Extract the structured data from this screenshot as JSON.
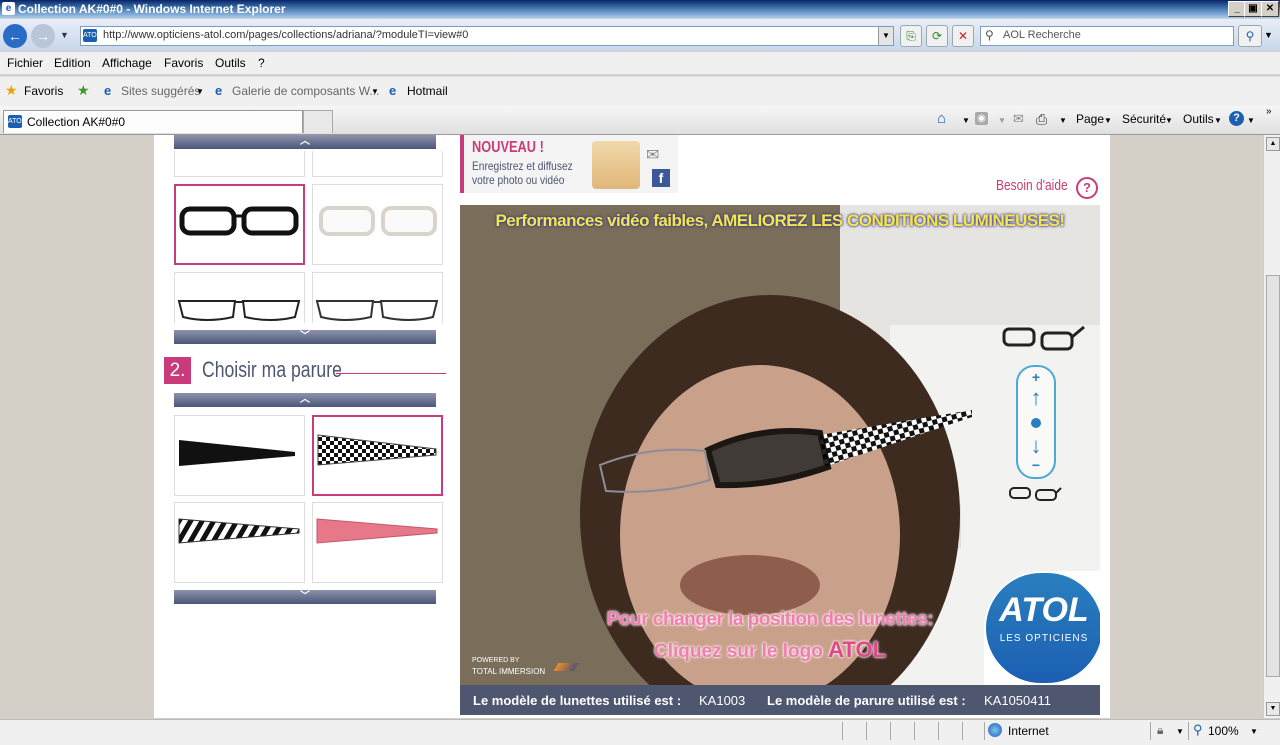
{
  "window": {
    "title": "Collection AK#0#0 - Windows Internet Explorer",
    "controls": [
      "_",
      "▣",
      "✕"
    ]
  },
  "nav": {
    "url": "http://www.opticiens-atol.com/pages/collections/adriana/?moduleTI=view#0",
    "search_placeholder": "AOL Recherche"
  },
  "menu": {
    "items": [
      "Fichier",
      "Edition",
      "Affichage",
      "Favoris",
      "Outils",
      "?"
    ]
  },
  "favorites": {
    "label": "Favoris",
    "links": [
      "Sites suggérés",
      "Galerie de composants W...",
      "Hotmail"
    ]
  },
  "tab": {
    "title": "Collection AK#0#0"
  },
  "command": {
    "items": [
      "Page",
      "Sécurité",
      "Outils"
    ]
  },
  "promo": {
    "headline": "NOUVEAU !",
    "line1": "Enregistrez et diffusez",
    "line2": "votre photo ou vidéo"
  },
  "help": {
    "label": "Besoin d'aide"
  },
  "section2": {
    "number": "2.",
    "title": "Choisir ma parure"
  },
  "webcam": {
    "warning": "Performances vidéo faibles, AMELIOREZ LES CONDITIONS LUMINEUSES!",
    "hint_line1": "Pour changer la position des lunettes:",
    "hint_line2": "Cliquez sur le logo ",
    "hint_brand": "ATOL",
    "powered_by": "POWERED BY",
    "powered_brand": "TOTAL IMMERSION",
    "logo_text": "ATOL",
    "logo_sub": "LES OPTICIENS"
  },
  "info": {
    "frame_label": "Le modèle de lunettes utilisé est :",
    "frame_value": "KA1003",
    "parure_label": "Le modèle de parure utilisé est :",
    "parure_value": "KA1050411"
  },
  "status": {
    "zone": "Internet",
    "zoom": "100%"
  },
  "colors": {
    "accent": "#c93b7a",
    "bar": "#4e5670",
    "ie_blue": "#1b5fb2"
  }
}
